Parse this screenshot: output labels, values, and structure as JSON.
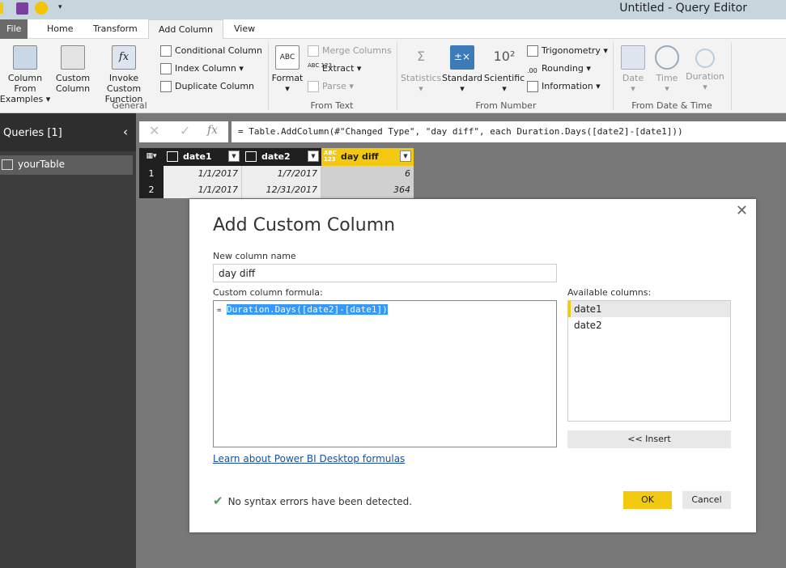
{
  "window": {
    "title": "Untitled - Query Editor"
  },
  "tabs": [
    {
      "label": "File"
    },
    {
      "label": "Home"
    },
    {
      "label": "Transform"
    },
    {
      "label": "Add Column"
    },
    {
      "label": "View"
    }
  ],
  "ribbon": {
    "general": {
      "label": "General",
      "column_from_examples": "Column From",
      "column_from_examples2": "Examples",
      "custom_column": "Custom",
      "custom_column2": "Column",
      "invoke_custom_function": "Invoke Custom",
      "invoke_custom_function2": "Function",
      "conditional_column": "Conditional Column",
      "index_column": "Index Column",
      "duplicate_column": "Duplicate Column"
    },
    "from_text": {
      "label": "From Text",
      "format": "Format",
      "merge_columns": "Merge Columns",
      "extract": "Extract",
      "parse": "Parse"
    },
    "from_number": {
      "label": "From Number",
      "statistics": "Statistics",
      "standard": "Standard",
      "scientific": "Scientific",
      "trigonometry": "Trigonometry",
      "rounding": "Rounding",
      "information": "Information"
    },
    "from_datetime": {
      "label": "From Date & Time",
      "date": "Date",
      "time": "Time",
      "duration": "Duration"
    }
  },
  "queries": {
    "header": "Queries [1]",
    "items": [
      {
        "label": "yourTable"
      }
    ]
  },
  "formula_bar": {
    "fx": "fx",
    "text": "= Table.AddColumn(#\"Changed Type\", \"day diff\", each Duration.Days([date2]-[date1]))"
  },
  "table": {
    "columns": [
      {
        "label": "date1",
        "type_icon": "date-icon"
      },
      {
        "label": "date2",
        "type_icon": "date-icon"
      },
      {
        "label": "day diff",
        "type_icon": "any-type-icon"
      }
    ],
    "rows": [
      {
        "n": "1",
        "date1": "1/1/2017",
        "date2": "1/7/2017",
        "diff": "6"
      },
      {
        "n": "2",
        "date1": "1/1/2017",
        "date2": "12/31/2017",
        "diff": "364"
      }
    ]
  },
  "dialog": {
    "title": "Add Custom Column",
    "name_label": "New column name",
    "name_value": "day diff",
    "formula_label": "Custom column formula:",
    "formula_prefix": "=",
    "formula_value": "Duration.Days([date2]-[date1])",
    "available_label": "Available columns:",
    "available": [
      "date1",
      "date2"
    ],
    "insert": "<< Insert",
    "learn_link": "Learn about Power BI Desktop formulas",
    "status": "No syntax errors have been detected.",
    "ok": "OK",
    "cancel": "Cancel"
  },
  "colors": {
    "accent": "#f2c811",
    "selection": "#3399ff",
    "check": "#4a9a6a"
  }
}
